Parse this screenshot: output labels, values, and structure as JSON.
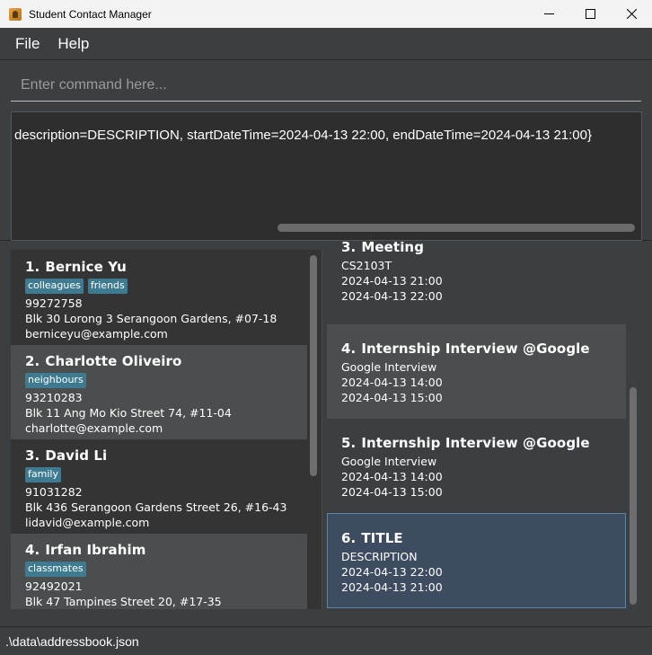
{
  "window": {
    "title": "Student Contact Manager"
  },
  "menu": {
    "file": "File",
    "help": "Help"
  },
  "command": {
    "placeholder": "Enter command here..."
  },
  "result": {
    "text": "description=DESCRIPTION, startDateTime=2024-04-13 22:00, endDateTime=2024-04-13 21:00}"
  },
  "persons": [
    {
      "index": "1.",
      "name": "Bernice Yu",
      "tags": [
        "colleagues",
        "friends"
      ],
      "phone": "99272758",
      "address": "Blk 30 Lorong 3 Serangoon Gardens, #07-18",
      "email": "berniceyu@example.com"
    },
    {
      "index": "2.",
      "name": "Charlotte Oliveiro",
      "tags": [
        "neighbours"
      ],
      "phone": "93210283",
      "address": "Blk 11 Ang Mo Kio Street 74, #11-04",
      "email": "charlotte@example.com"
    },
    {
      "index": "3.",
      "name": "David Li",
      "tags": [
        "family"
      ],
      "phone": "91031282",
      "address": "Blk 436 Serangoon Gardens Street 26, #16-43",
      "email": "lidavid@example.com"
    },
    {
      "index": "4.",
      "name": "Irfan Ibrahim",
      "tags": [
        "classmates"
      ],
      "phone": "92492021",
      "address": "Blk 47 Tampines Street 20, #17-35",
      "email": ""
    }
  ],
  "events": [
    {
      "index": "3.",
      "title": "Meeting",
      "description": "CS2103T",
      "start": "2024-04-13 21:00",
      "end": "2024-04-13 22:00"
    },
    {
      "index": "4.",
      "title": "Internship Interview @Google",
      "description": "Google Interview",
      "start": "2024-04-13 14:00",
      "end": "2024-04-13 15:00"
    },
    {
      "index": "5.",
      "title": "Internship Interview @Google",
      "description": "Google Interview",
      "start": "2024-04-13 14:00",
      "end": "2024-04-13 15:00"
    },
    {
      "index": "6.",
      "title": "TITLE",
      "description": "DESCRIPTION",
      "start": "2024-04-13 22:00",
      "end": "2024-04-13 21:00"
    }
  ],
  "status": {
    "path": ".\\data\\addressbook.json"
  },
  "colors": {
    "tag": "#3e7b91",
    "selected_bg": "#3e4c61",
    "selected_border": "#5a86a6",
    "dark_bg": "#343434",
    "light_bg": "#4b4e4f"
  }
}
